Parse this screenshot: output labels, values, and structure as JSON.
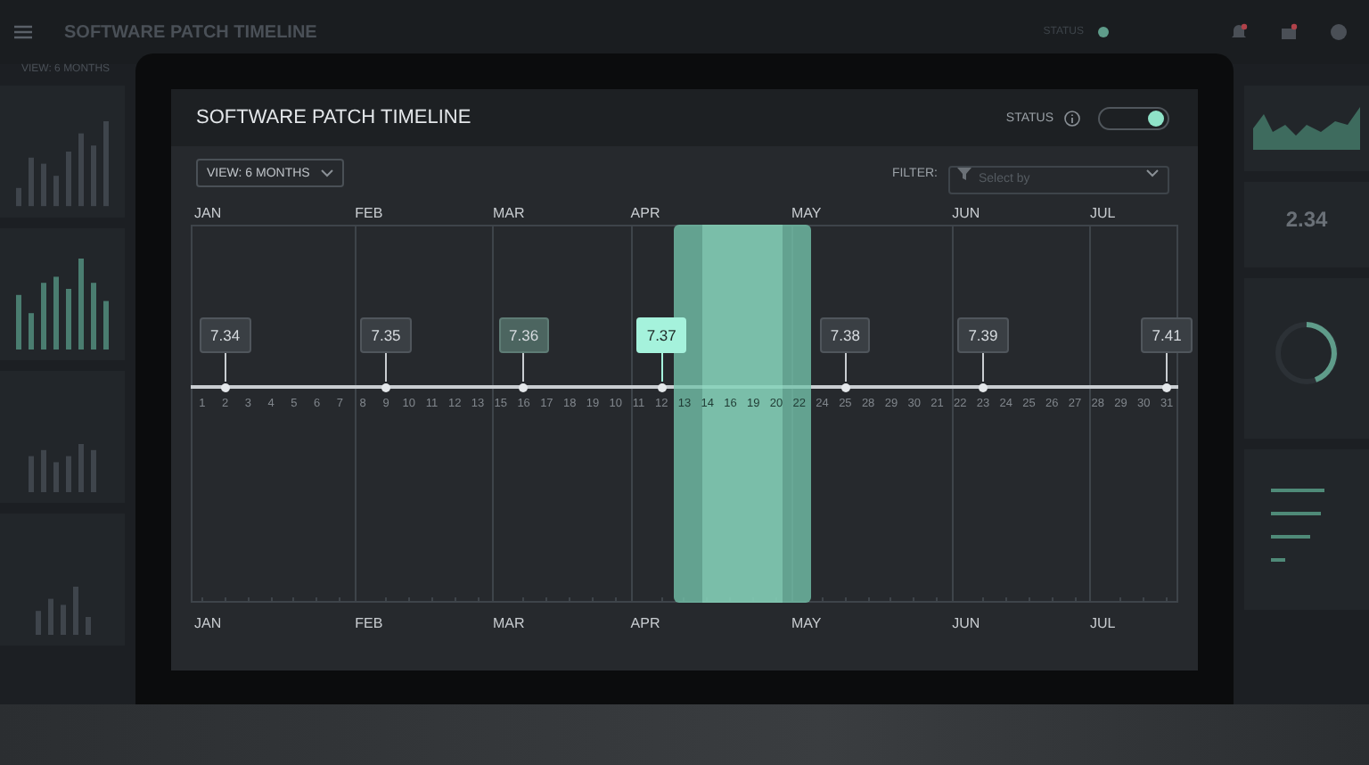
{
  "backdrop": {
    "title": "SOFTWARE PATCH TIMELINE",
    "status_label": "STATUS",
    "view": "VIEW: 6 MONTHS",
    "stat_value": "2.34"
  },
  "panel": {
    "title": "SOFTWARE PATCH TIMELINE",
    "status": {
      "label": "STATUS",
      "on": true
    },
    "view": {
      "label": "VIEW: 6 MONTHS"
    },
    "filter": {
      "label": "FILTER:",
      "placeholder": "Select by"
    },
    "months_top": [
      "JAN",
      "FEB",
      "MAR",
      "APR",
      "MAY",
      "JUN",
      "JUL"
    ],
    "days": [
      {
        "label": "1",
        "month_start": false,
        "in_window": false
      },
      {
        "label": "2",
        "month_start": false,
        "in_window": false,
        "release": {
          "version": "7.34",
          "kind": "default"
        }
      },
      {
        "label": "3",
        "month_start": false,
        "in_window": false
      },
      {
        "label": "4",
        "month_start": false,
        "in_window": false
      },
      {
        "label": "5",
        "month_start": false,
        "in_window": false
      },
      {
        "label": "6",
        "month_start": false,
        "in_window": false
      },
      {
        "label": "7",
        "month_start": false,
        "in_window": false
      },
      {
        "label": "8",
        "month_start": true,
        "in_window": false
      },
      {
        "label": "9",
        "month_start": false,
        "in_window": false,
        "release": {
          "version": "7.35",
          "kind": "default"
        }
      },
      {
        "label": "10",
        "month_start": false,
        "in_window": false
      },
      {
        "label": "11",
        "month_start": false,
        "in_window": false
      },
      {
        "label": "12",
        "month_start": false,
        "in_window": false
      },
      {
        "label": "13",
        "month_start": false,
        "in_window": false
      },
      {
        "label": "15",
        "month_start": true,
        "in_window": false
      },
      {
        "label": "16",
        "month_start": false,
        "in_window": false,
        "release": {
          "version": "7.36",
          "kind": "past"
        }
      },
      {
        "label": "17",
        "month_start": false,
        "in_window": false
      },
      {
        "label": "18",
        "month_start": false,
        "in_window": false
      },
      {
        "label": "19",
        "month_start": false,
        "in_window": false
      },
      {
        "label": "10",
        "month_start": false,
        "in_window": false
      },
      {
        "label": "11",
        "month_start": true,
        "in_window": false
      },
      {
        "label": "12",
        "month_start": false,
        "in_window": false,
        "release": {
          "version": "7.37",
          "kind": "current"
        }
      },
      {
        "label": "13",
        "month_start": false,
        "in_window": true
      },
      {
        "label": "14",
        "month_start": false,
        "in_window": true
      },
      {
        "label": "16",
        "month_start": false,
        "in_window": true
      },
      {
        "label": "19",
        "month_start": false,
        "in_window": true
      },
      {
        "label": "20",
        "month_start": false,
        "in_window": true
      },
      {
        "label": "22",
        "month_start": true,
        "in_window": true
      },
      {
        "label": "24",
        "month_start": false,
        "in_window": false
      },
      {
        "label": "25",
        "month_start": false,
        "in_window": false,
        "release": {
          "version": "7.38",
          "kind": "default"
        }
      },
      {
        "label": "28",
        "month_start": false,
        "in_window": false
      },
      {
        "label": "29",
        "month_start": false,
        "in_window": false
      },
      {
        "label": "30",
        "month_start": false,
        "in_window": false
      },
      {
        "label": "21",
        "month_start": false,
        "in_window": false
      },
      {
        "label": "22",
        "month_start": true,
        "in_window": false
      },
      {
        "label": "23",
        "month_start": false,
        "in_window": false,
        "release": {
          "version": "7.39",
          "kind": "default"
        }
      },
      {
        "label": "24",
        "month_start": false,
        "in_window": false
      },
      {
        "label": "25",
        "month_start": false,
        "in_window": false
      },
      {
        "label": "26",
        "month_start": false,
        "in_window": false
      },
      {
        "label": "27",
        "month_start": false,
        "in_window": false
      },
      {
        "label": "28",
        "month_start": true,
        "in_window": false
      },
      {
        "label": "29",
        "month_start": false,
        "in_window": false
      },
      {
        "label": "30",
        "month_start": false,
        "in_window": false
      },
      {
        "label": "31",
        "month_start": false,
        "in_window": false,
        "release": {
          "version": "7.41",
          "kind": "default"
        }
      }
    ],
    "months_bottom": [
      "JAN",
      "FEB",
      "MAR",
      "APR",
      "MAY",
      "JUN",
      "JUL"
    ]
  }
}
